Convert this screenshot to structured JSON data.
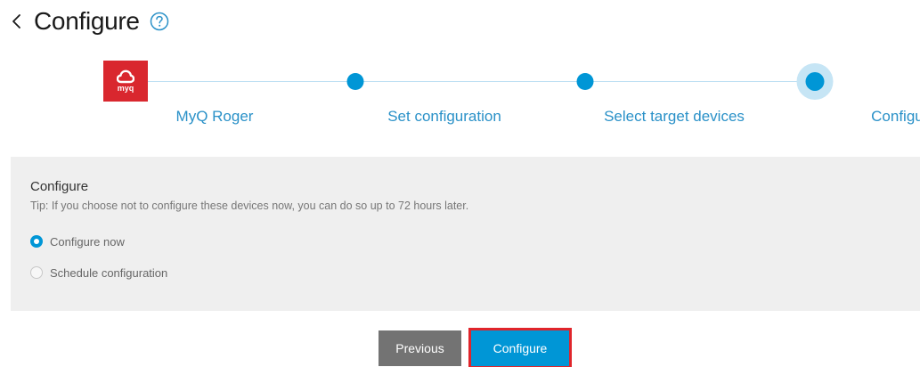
{
  "header": {
    "title": "Configure",
    "back_icon": "chevron-left-icon",
    "help_icon": "question-circle-icon"
  },
  "stepper": {
    "steps": [
      {
        "label": "MyQ Roger",
        "marker": "myq-logo",
        "logo_text": "myq",
        "state": "done"
      },
      {
        "label": "Set configuration",
        "marker": "dot",
        "state": "done"
      },
      {
        "label": "Select target devices",
        "marker": "dot",
        "state": "done"
      },
      {
        "label": "Configure",
        "marker": "dot",
        "state": "current"
      }
    ]
  },
  "panel": {
    "title": "Configure",
    "tip": "Tip: If you choose not to configure these devices now, you can do so up to 72 hours later.",
    "options": [
      {
        "label": "Configure now",
        "selected": true
      },
      {
        "label": "Schedule configuration",
        "selected": false
      }
    ]
  },
  "buttons": {
    "previous_label": "Previous",
    "configure_label": "Configure"
  },
  "colors": {
    "accent": "#0096d6",
    "step_label": "#2a91c8",
    "logo_red": "#d9272e",
    "highlight_border": "#e0252b",
    "panel_bg": "#efefef",
    "previous_bg": "#737373"
  }
}
